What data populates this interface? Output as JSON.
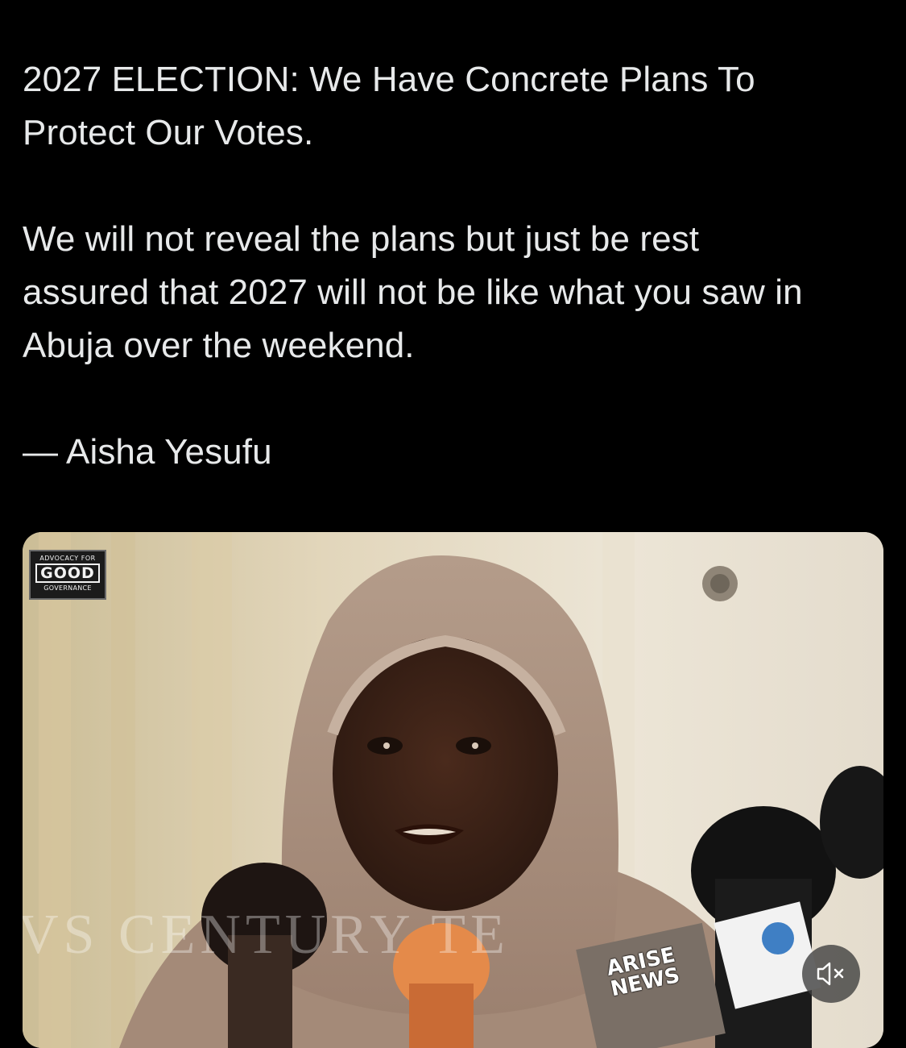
{
  "post": {
    "headline_line1": "2027 ELECTION: We Have Concrete Plans To",
    "headline_line2": "Protect Our Votes.",
    "body_line1": "We will not reveal the plans but just be rest",
    "body_line2": "assured that 2027 will not be like what you saw in",
    "body_line3": "Abuja over the weekend.",
    "attribution": "— Aisha Yesufu"
  },
  "media": {
    "logo": {
      "top": "ADVOCACY FOR",
      "middle": "GOOD",
      "bottom": "GOVERNANCE"
    },
    "watermark_text": "VS CENTURY TE",
    "mic_label_line1": "ARISE",
    "mic_label_line2": "NEWS",
    "mute_icon": "speaker-muted-icon"
  },
  "colors": {
    "background": "#000000",
    "text": "#e7e9ea"
  }
}
